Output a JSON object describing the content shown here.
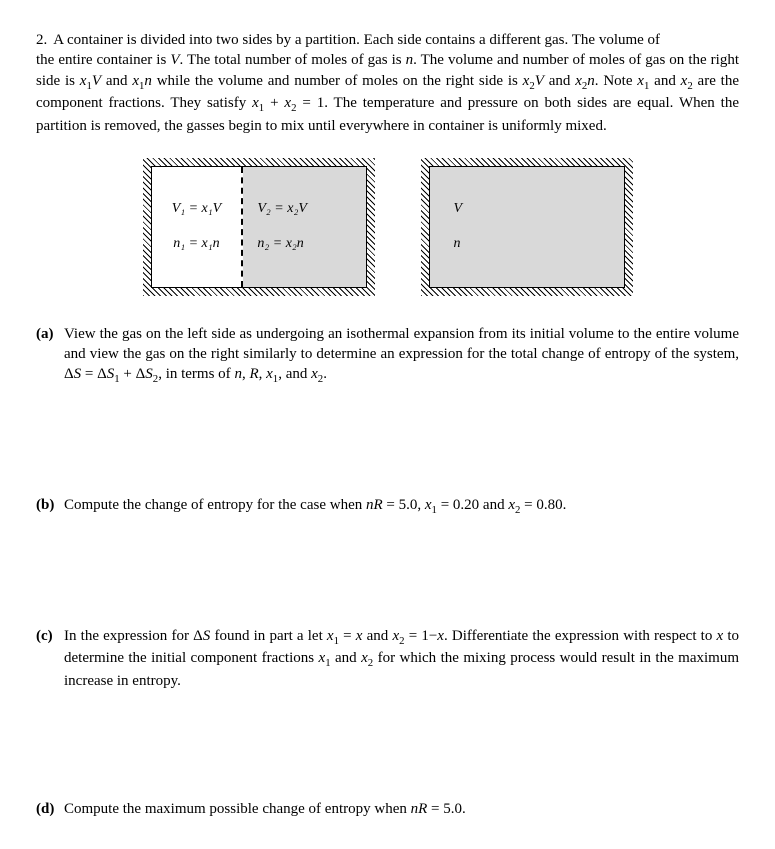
{
  "problem": {
    "number": "2.",
    "text": "A container is divided into two sides by a partition. Each side contains a different gas. The volume of the entire container is V. The total number of moles of gas is n. The volume and number of moles of gas on the right side is x₁V and x₁n while the volume and number of moles on the right side is x₂V and x₂n. Note x₁ and x₂ are the component fractions. They satisfy x₁ + x₂ = 1. The temperature and pressure on both sides are equal. When the partition is removed, the gasses begin to mix until everywhere in container is uniformly mixed."
  },
  "figure": {
    "left": {
      "V1": "V₁ = x₁V",
      "n1": "n₁ = x₁n",
      "V2": "V₂ = x₂V",
      "n2": "n₂ = x₂n"
    },
    "right": {
      "V": "V",
      "n": "n"
    }
  },
  "parts": {
    "a": {
      "label": "(a)",
      "text": "View the gas on the left side as undergoing an isothermal expansion from its initial volume to the entire volume and view the gas on the right similarly to determine an expression for the total change of entropy of the system, ΔS = ΔS₁ + ΔS₂, in terms of n, R, x₁, and x₂."
    },
    "b": {
      "label": "(b)",
      "text": "Compute the change of entropy for the case when nR = 5.0, x₁ = 0.20 and x₂ = 0.80."
    },
    "c": {
      "label": "(c)",
      "text": "In the expression for ΔS found in part a let x₁ = x and x₂ = 1−x. Differentiate the expression with respect to x to determine the initial component fractions x₁ and x₂ for which the mixing process would result in the maximum increase in entropy."
    },
    "d": {
      "label": "(d)",
      "text": "Compute the maximum possible change of entropy when nR = 5.0."
    }
  }
}
